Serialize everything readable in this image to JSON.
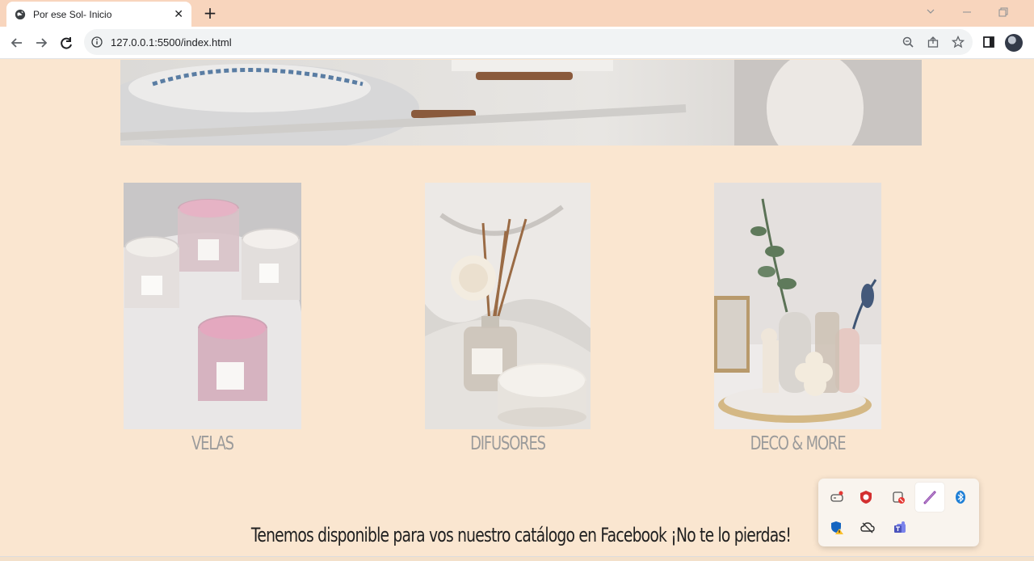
{
  "browser": {
    "tab_title": "Por ese Sol- Inicio",
    "tab_close": "✕",
    "new_tab": "+",
    "url": "127.0.0.1:5500/index.html",
    "window_controls": [
      "chevron-down",
      "minimize",
      "restore"
    ]
  },
  "products": [
    {
      "label": "VELAS",
      "image": "candles-photo"
    },
    {
      "label": "DIFUSORES",
      "image": "reed-diffuser-photo"
    },
    {
      "label": "DECO & MORE",
      "image": "decor-tray-photo"
    }
  ],
  "promo_text": "Tenemos disponible para vos nuestro catálogo en Facebook ¡No te lo pierdas!",
  "tray": {
    "icons": [
      "gamepad-icon",
      "security-shield-icon",
      "app-blocked-icon",
      "pen-icon",
      "bluetooth-icon",
      "defender-warning-icon",
      "cloud-off-icon",
      "teams-icon"
    ]
  },
  "colors": {
    "page_bg": "#fae6d0",
    "tab_strip": "#f8d5bd",
    "label_gray": "#9b9b9b"
  }
}
